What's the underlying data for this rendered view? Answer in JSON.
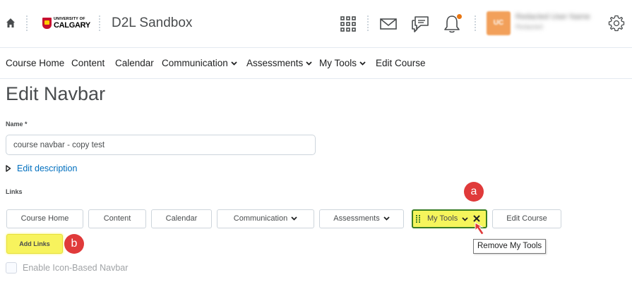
{
  "header": {
    "logo": {
      "line1": "UNIVERSITY OF",
      "line2": "CALGARY"
    },
    "org_title": "D2L Sandbox",
    "user": {
      "initials": "UC",
      "name": "Redacted User Name",
      "role": "Redacted"
    },
    "notification_dot_color": "#e87511",
    "icons": [
      "home-icon",
      "waffle-grid-icon",
      "mail-icon",
      "chat-icon",
      "bell-icon",
      "gear-icon"
    ]
  },
  "navbar": {
    "items": [
      {
        "label": "Course Home"
      },
      {
        "label": "Content"
      },
      {
        "label": "Calendar"
      },
      {
        "label": "Communication"
      },
      {
        "label": "Assessments"
      },
      {
        "label": "My Tools"
      },
      {
        "label": "Edit Course"
      }
    ]
  },
  "page": {
    "title": "Edit Navbar",
    "name_label": "Name *",
    "name_value": "course navbar - copy test",
    "edit_description": "Edit description",
    "links_label": "Links",
    "links": [
      {
        "label": "Course Home"
      },
      {
        "label": "Content"
      },
      {
        "label": "Calendar"
      },
      {
        "label": "Communication"
      },
      {
        "label": "Assessments"
      },
      {
        "label": "My Tools",
        "selected": true
      },
      {
        "label": "Edit Course"
      }
    ],
    "add_links": "Add Links",
    "tooltip": "Remove My Tools",
    "icon_based_label": "Enable Icon-Based Navbar"
  },
  "annotations": {
    "a": "a",
    "b": "b",
    "color": "#e03a3a"
  },
  "colors": {
    "link": "#006fbf",
    "highlight": "#f5f55c",
    "highlight_border": "#3a7d24"
  }
}
